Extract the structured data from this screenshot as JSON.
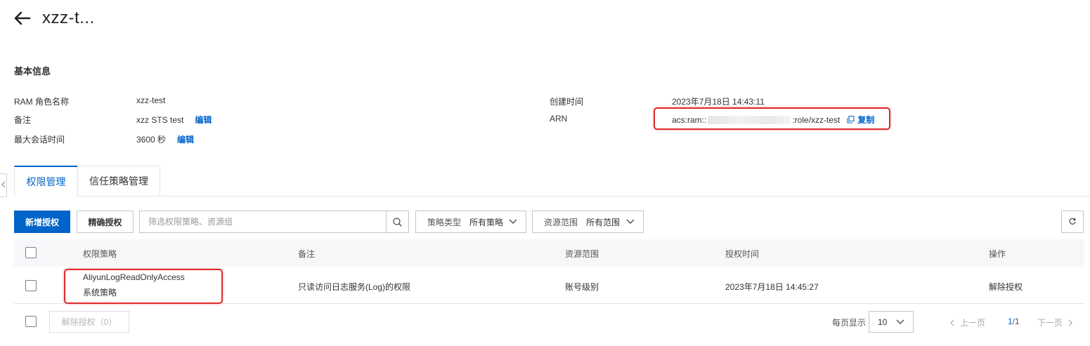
{
  "header": {
    "title": "xzz-t..."
  },
  "basic_info": {
    "section_title": "基本信息",
    "role_name_label": "RAM 角色名称",
    "role_name_value": "xzz-test",
    "note_label": "备注",
    "note_value": "xzz STS test",
    "note_edit": "编辑",
    "max_session_label": "最大会话时间",
    "max_session_value": "3600 秒",
    "max_session_edit": "编辑",
    "created_label": "创建时间",
    "created_value": "2023年7月18日 14:43:11",
    "arn_label": "ARN",
    "arn_prefix": "acs:ram::",
    "arn_suffix": ":role/xzz-test",
    "arn_copy": "复制"
  },
  "tabs": [
    {
      "label": "权限管理",
      "active": true
    },
    {
      "label": "信任策略管理",
      "active": false
    }
  ],
  "toolbar": {
    "add_button": "新增授权",
    "precise_button": "精确授权",
    "search_placeholder": "筛选权限策略、资源组",
    "policy_type_label": "策略类型",
    "policy_type_value": "所有策略",
    "scope_label": "资源范围",
    "scope_value": "所有范围"
  },
  "table": {
    "columns": [
      "权限策略",
      "备注",
      "资源范围",
      "授权时间",
      "操作"
    ],
    "rows": [
      {
        "policy_name": "AliyunLogReadOnlyAccess",
        "policy_type": "系统策略",
        "note": "只读访问日志服务(Log)的权限",
        "scope": "账号级别",
        "time": "2023年7月18日 14:45:27",
        "action": "解除授权"
      }
    ]
  },
  "footer": {
    "revoke_button": "解除授权（0）",
    "page_size_label": "每页显示",
    "page_size_value": "10",
    "prev": "上一页",
    "current_page": "1",
    "page_sep": "/1",
    "next": "下一页"
  },
  "colors": {
    "primary": "#0064c8",
    "highlight": "#e12a2a"
  }
}
